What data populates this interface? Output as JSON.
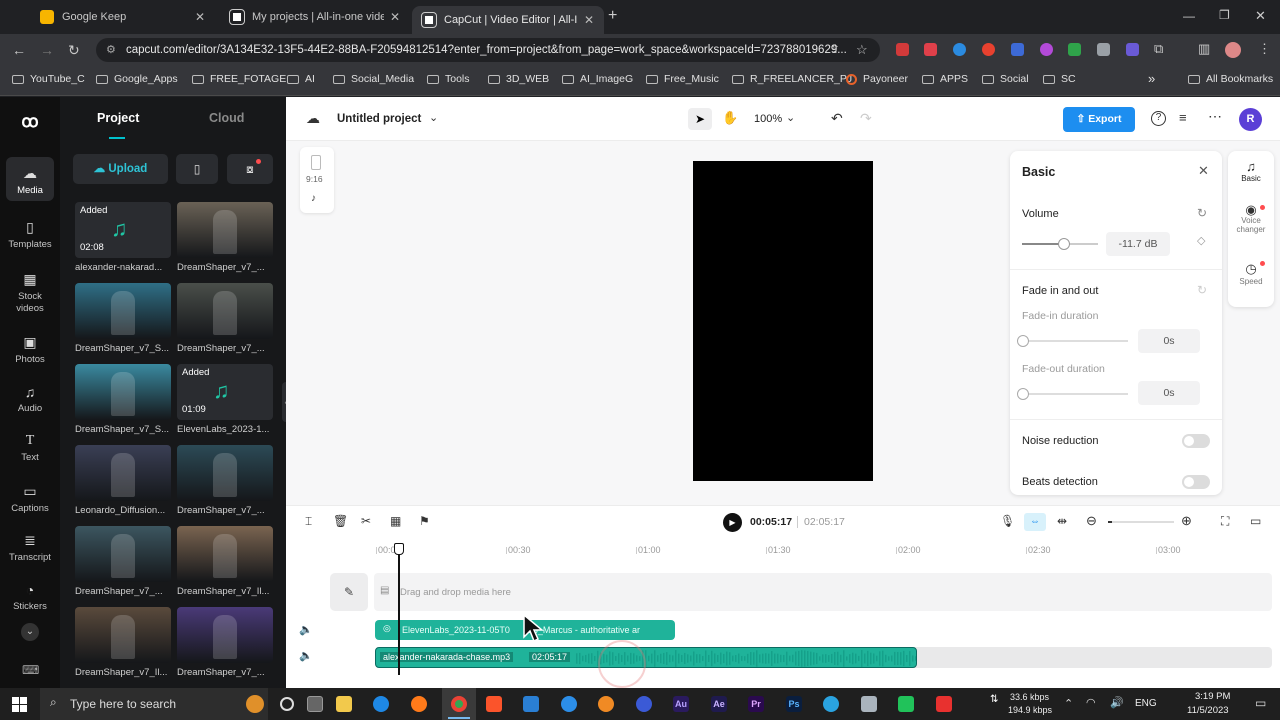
{
  "browser": {
    "tabs": [
      {
        "title": "Google Keep",
        "active": false,
        "color": "#f7b500"
      },
      {
        "title": "My projects | All-in-one video",
        "active": false,
        "color": "#e8e8e8"
      },
      {
        "title": "CapCut | Video Editor | All-In-",
        "active": true,
        "color": "#e8e8e8"
      }
    ],
    "new_tab": "+",
    "url": "capcut.com/editor/3A134E32-13F5-44E2-88BA-F20594812514?enter_from=project&from_page=work_space&workspaceId=723788019629...",
    "bookmarks": [
      "YouTube_C",
      "Google_Apps",
      "FREE_FOTAGE",
      "AI",
      "Social_Media",
      "Tools",
      "3D_WEB",
      "AI_ImageG",
      "Free_Music",
      "R_FREELANCER_PJ",
      "Payoneer",
      "APPS",
      "Social",
      "SC"
    ],
    "bookmarks_more": "»",
    "all_bookmarks": "All Bookmarks"
  },
  "leftnav": [
    {
      "label": "Media",
      "icon": "cloud-upload-icon",
      "active": true
    },
    {
      "label": "Templates",
      "icon": "template-icon"
    },
    {
      "label": "Stock videos",
      "icon": "film-icon"
    },
    {
      "label": "Photos",
      "icon": "image-icon"
    },
    {
      "label": "Audio",
      "icon": "music-icon"
    },
    {
      "label": "Text",
      "icon": "text-icon"
    },
    {
      "label": "Captions",
      "icon": "captions-icon"
    },
    {
      "label": "Transcript",
      "icon": "transcript-icon"
    },
    {
      "label": "Stickers",
      "icon": "sticker-icon"
    }
  ],
  "media": {
    "tab_project": "Project",
    "tab_cloud": "Cloud",
    "upload_label": "Upload",
    "items": [
      {
        "label": "alexander-nakarad...",
        "badge": "Added",
        "duration": "02:08",
        "kind": "audio"
      },
      {
        "label": "DreamShaper_v7_...",
        "kind": "image",
        "tone": "#6a6256"
      },
      {
        "label": "DreamShaper_v7_S...",
        "kind": "image",
        "tone": "#2f6f86"
      },
      {
        "label": "DreamShaper_v7_...",
        "kind": "image",
        "tone": "#4a4f4a"
      },
      {
        "label": "DreamShaper_v7_S...",
        "kind": "image",
        "tone": "#3a8aa0"
      },
      {
        "label": "ElevenLabs_2023-1...",
        "badge": "Added",
        "duration": "01:09",
        "kind": "audio"
      },
      {
        "label": "Leonardo_Diffusion...",
        "kind": "image",
        "tone": "#3a3f55"
      },
      {
        "label": "DreamShaper_v7_...",
        "kind": "image",
        "tone": "#2c4a56"
      },
      {
        "label": "DreamShaper_v7_...",
        "kind": "image",
        "tone": "#3c5660"
      },
      {
        "label": "DreamShaper_v7_Il...",
        "kind": "image",
        "tone": "#7a6450"
      },
      {
        "label": "DreamShaper_v7_Il...",
        "kind": "image",
        "tone": "#5a4a3c"
      },
      {
        "label": "DreamShaper_v7_...",
        "kind": "image",
        "tone": "#4a3a78"
      }
    ]
  },
  "editor": {
    "project_title": "Untitled project",
    "zoom": "100%",
    "export_label": "Export",
    "avatar_letter": "R",
    "ratio_label": "9:16"
  },
  "props": {
    "title": "Basic",
    "volume_label": "Volume",
    "volume_value": "-11.7 dB",
    "volume_level": 0.55,
    "fade_label": "Fade in and out",
    "fade_in_label": "Fade-in duration",
    "fade_in_value": "0s",
    "fade_out_label": "Fade-out duration",
    "fade_out_value": "0s",
    "noise_label": "Noise reduction",
    "beats_label": "Beats detection"
  },
  "dock": [
    {
      "label": "Basic"
    },
    {
      "label": "Voice changer"
    },
    {
      "label": "Speed"
    }
  ],
  "timeline": {
    "current_time": "00:05:17",
    "total_time": "02:05:17",
    "ticks": [
      "00:00",
      "00:30",
      "01:00",
      "01:30",
      "02:00",
      "02:30",
      "03:00"
    ],
    "drop_hint": "Drag and drop media here",
    "clip1_label": "ElevenLabs_2023-11-05T0  38_Marcus - authoritative ar",
    "clip2_label": "alexander-nakarada-chase.mp3",
    "clip2_duration": "02:05:17"
  },
  "taskbar": {
    "search_placeholder": "Type here to search",
    "net_up": "33.6 kbps",
    "net_down": "194.9 kbps",
    "lang": "ENG",
    "time": "3:19 PM",
    "date": "11/5/2023"
  }
}
